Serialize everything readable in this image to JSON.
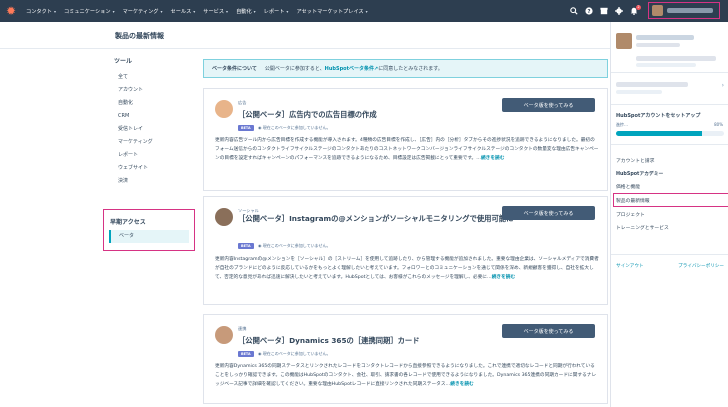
{
  "nav": {
    "logo": "✹",
    "items": [
      {
        "label": "コンタクト"
      },
      {
        "label": "コミュニケーション"
      },
      {
        "label": "マーケティング"
      },
      {
        "label": "セールス"
      },
      {
        "label": "サービス"
      },
      {
        "label": "自動化"
      },
      {
        "label": "レポート"
      },
      {
        "label": "アセットマーケットプレイス"
      }
    ],
    "chevron": "▾",
    "notification_count": "2",
    "icons": [
      "search-icon",
      "help-icon",
      "marketplace-icon",
      "settings-icon",
      "bell-icon"
    ]
  },
  "page": {
    "title": "製品の最新情報"
  },
  "sidebar": {
    "tools_heading": "ツール",
    "items": [
      "全て",
      "アカウント",
      "自動化",
      "CRM",
      "受信トレイ",
      "マーケティング",
      "レポート",
      "ウェブサイト",
      "決済"
    ],
    "early_access_heading": "早期アクセス",
    "active_item": "ベータ"
  },
  "banner": {
    "title": "ベータ条件について",
    "text": "公開ベータに参加すると、",
    "link": "HubSpotベータ条件",
    "link_icon": "↗",
    "suffix": "に同意したとみなされます。"
  },
  "cards": [
    {
      "category": "広告",
      "title": "［公開ベータ］広告内での広告目標の作成",
      "badge": "BETA",
      "meta": "◉ 現在このベータに参加していません。",
      "desc": "更新内容広告ツール内から広告目標を作成する機能が導入されます。4種類の広告目標を作成し、［広告］内の［分析］タブからその進捗状況を追跡できるようになりました。最初のフォーム送信からのコンタクトライフサイクルステージのコンタクトあたりのコストネットワークコンバージョンライフサイクルステージのコンタクトの数量変な理由広告キャンペーンの目標を設定すればキャンペーンのパフォーマンスを追跡できるようになるため、目標設定は広告掲載にとって重要です。…",
      "more": "続きを読む",
      "button": "ベータ版を使ってみる"
    },
    {
      "category": "ソーシャル",
      "title": "［公開ベータ］Instagramの@メンションがソーシャルモニタリングで使用可能に",
      "badge": "BETA",
      "meta": "◉ 現在このベータに参加していません。",
      "desc": "更新内容Instagramの@メンションを［ソーシャル］の［ストリーム］を使用して追跡したり、から管理する機能が追加されました。重要な理由企業は、ソーシャルメディアで消費者が自社のブランドにどのように反応しているかをもっとよく理解したいと考えています。フォロワーとのコミュニケーションを通じて関係を深め、新規顧客を獲得し、自社を拡大して、否定的な意見があれば迅速に解決したいと考えています。HubSpotとしては、お客様がこれらのメッセージを理解し、必要に…",
      "more": "続きを読む",
      "button": "ベータ版を使ってみる"
    },
    {
      "category": "連携",
      "title": "［公開ベータ］Dynamics 365の［連携同期］カード",
      "badge": "BETA",
      "meta": "◉ 現在このベータに参加していません。",
      "desc": "更新内容Dynamics 365の同期ステータスとリンクされたレコードをコンタクトレコードから直接参照できるようになりました。これで連携で適切なレコードと同期が行われていることをしっかり確認できます。この機能はHubSpotのコンタクト、会社、取引、請求書の各レコードで使用できるようになりました。Dynamics 365連携の同期カードに関するナレッジベース記事で詳細を確認してください。重要な理由HubSpotレコードに直接リンクされた同期ステータス…",
      "more": "続きを読む",
      "button": "ベータ版を使ってみる"
    }
  ],
  "dropdown": {
    "setup_title": "HubSpotアカウントをセットアップ",
    "setup_status": "進捗…",
    "setup_percent": "80%",
    "setup_progress": 0.8,
    "items": [
      "アカウントと請求",
      "HubSpotアカデミー",
      "価格と機能",
      "製品の最新情報",
      "プロジェクト",
      "トレーニングとサービス"
    ],
    "signout": "サインアウト",
    "privacy": "プライバシーポリシー"
  }
}
